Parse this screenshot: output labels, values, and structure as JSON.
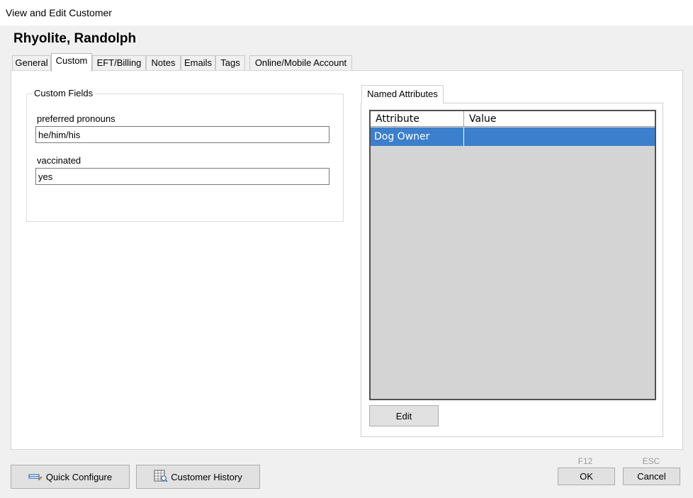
{
  "window": {
    "title": "View and Edit Customer"
  },
  "customer": {
    "name": "Rhyolite, Randolph"
  },
  "tabs": [
    {
      "label": "General"
    },
    {
      "label": "Custom",
      "active": true
    },
    {
      "label": "EFT/Billing"
    },
    {
      "label": "Notes"
    },
    {
      "label": "Emails"
    },
    {
      "label": "Tags"
    },
    {
      "label": "Online/Mobile Account"
    }
  ],
  "custom_fields": {
    "legend": "Custom Fields",
    "fields": [
      {
        "label": "preferred pronouns",
        "value": "he/him/his"
      },
      {
        "label": "vaccinated",
        "value": "yes"
      }
    ]
  },
  "named_attributes": {
    "tab_label": "Named Attributes",
    "columns": [
      "Attribute",
      "Value"
    ],
    "rows": [
      {
        "attribute": "Dog Owner",
        "value": "",
        "selected": true
      }
    ],
    "edit_label": "Edit"
  },
  "footer": {
    "quick_configure_label": "Quick Configure",
    "customer_history_label": "Customer History",
    "ok_label": "OK",
    "ok_key": "F12",
    "cancel_label": "Cancel",
    "cancel_key": "ESC"
  },
  "colors": {
    "selection": "#3c7fcc",
    "grid_bg": "#d4d4d4"
  },
  "icons": {
    "quick_configure": "configure-icon",
    "customer_history": "history-icon"
  }
}
